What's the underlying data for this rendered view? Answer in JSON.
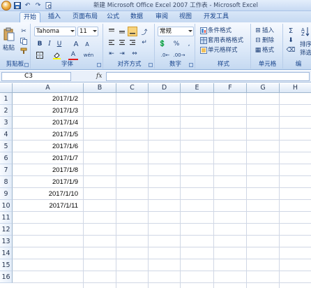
{
  "window": {
    "title": "新建 Microsoft Office Excel 2007 工作表 - Microsoft Excel"
  },
  "quick_access": [
    "save-icon",
    "undo-icon",
    "redo-icon",
    "print-preview-icon"
  ],
  "tabs": [
    {
      "label": "开始",
      "active": true
    },
    {
      "label": "插入"
    },
    {
      "label": "页面布局"
    },
    {
      "label": "公式"
    },
    {
      "label": "数据"
    },
    {
      "label": "审阅"
    },
    {
      "label": "视图"
    },
    {
      "label": "开发工具"
    }
  ],
  "ribbon": {
    "clipboard": {
      "paste_label": "粘贴",
      "group_label": "剪贴板"
    },
    "font": {
      "font_name": "Tahoma",
      "font_size": "11",
      "group_label": "字体",
      "bold": "B",
      "italic": "I",
      "underline": "U",
      "grow": "A",
      "shrink": "A",
      "color_a": "A",
      "phonetic": "wén"
    },
    "alignment": {
      "group_label": "对齐方式"
    },
    "number": {
      "format": "常规",
      "percent": "%",
      "comma": ",",
      "group_label": "数字"
    },
    "styles": {
      "conditional": "条件格式",
      "table_format": "套用表格格式",
      "cell_styles": "单元格样式",
      "group_label": "样式"
    },
    "cells": {
      "insert": "插入",
      "delete": "删除",
      "format": "格式",
      "group_label": "单元格"
    },
    "editing": {
      "sigma": "Σ",
      "sort": "排序",
      "filter": "筛选",
      "group_label": "编"
    }
  },
  "formula_bar": {
    "name_box": "C3",
    "fx_label": "fx",
    "content": ""
  },
  "sheet": {
    "columns": [
      "A",
      "B",
      "C",
      "D",
      "E",
      "F",
      "G",
      "H"
    ],
    "rows": [
      "1",
      "2",
      "3",
      "4",
      "5",
      "6",
      "7",
      "8",
      "9",
      "10",
      "11",
      "12",
      "13",
      "14",
      "15",
      "16"
    ],
    "column_a_values": [
      "2017/1/2",
      "2017/1/3",
      "2017/1/4",
      "2017/1/5",
      "2017/1/6",
      "2017/1/7",
      "2017/1/8",
      "2017/1/9",
      "2017/1/10",
      "2017/1/11"
    ]
  }
}
